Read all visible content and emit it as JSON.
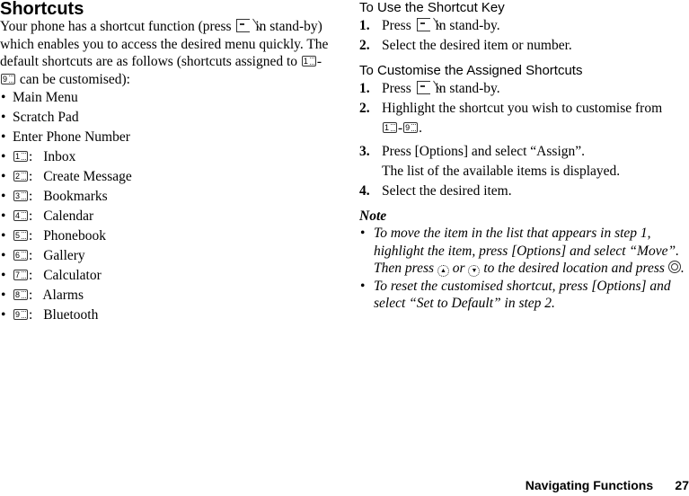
{
  "left": {
    "title": "Shortcuts",
    "intro": {
      "part1": "Your phone has a shortcut function (press",
      "part2": "in stand-by) which enables you to access the desired menu quickly. The default shortcuts are as follows (shortcuts assigned to",
      "dash": "-",
      "part3": "can be customised):",
      "icon_shortcut": "shortcut-softkey-icon",
      "range_from_key": "1",
      "range_to_key": "9"
    },
    "items": [
      {
        "key": null,
        "label": "Main Menu"
      },
      {
        "key": null,
        "label": "Scratch Pad"
      },
      {
        "key": null,
        "label": "Enter Phone Number"
      },
      {
        "key": "1",
        "label": "Inbox"
      },
      {
        "key": "2",
        "label": "Create Message"
      },
      {
        "key": "3",
        "label": "Bookmarks"
      },
      {
        "key": "4",
        "label": "Calendar"
      },
      {
        "key": "5",
        "label": "Phonebook"
      },
      {
        "key": "6",
        "label": "Gallery"
      },
      {
        "key": "7",
        "label": "Calculator"
      },
      {
        "key": "8",
        "label": "Alarms"
      },
      {
        "key": "9",
        "label": "Bluetooth"
      }
    ],
    "bullet": "•",
    "colon": ":"
  },
  "right": {
    "section1": {
      "heading": "To Use the Shortcut Key",
      "steps": [
        {
          "num": "1.",
          "pre": "Press",
          "post": "in stand-by."
        },
        {
          "num": "2.",
          "text": "Select the desired item or number."
        }
      ]
    },
    "section2": {
      "heading": "To Customise the Assigned Shortcuts",
      "steps": [
        {
          "num": "1.",
          "pre": "Press",
          "post": "in stand-by."
        },
        {
          "num": "2.",
          "text": "Highlight the shortcut you wish to customise from",
          "range_from_key": "1",
          "range_to_key": "9",
          "dash": "-",
          "end": "."
        },
        {
          "num": "3.",
          "text": "Press [Options] and select “Assign”.",
          "sub": "The list of the available items is displayed."
        },
        {
          "num": "4.",
          "text": "Select the desired item."
        }
      ]
    },
    "note": {
      "title": "Note",
      "items": [
        {
          "part1": "To move the item in the list that appears in step 1, highlight the item, press [Options] and select “Move”. Then press",
          "up_key": "▲",
          "or": "or",
          "down_key": "▼",
          "part2": "to the desired location and press",
          "end": "."
        },
        {
          "text": "To reset the customised shortcut, press [Options] and select “Set to Default” in step 2."
        }
      ]
    }
  },
  "footer": {
    "section": "Navigating Functions",
    "page": "27"
  }
}
